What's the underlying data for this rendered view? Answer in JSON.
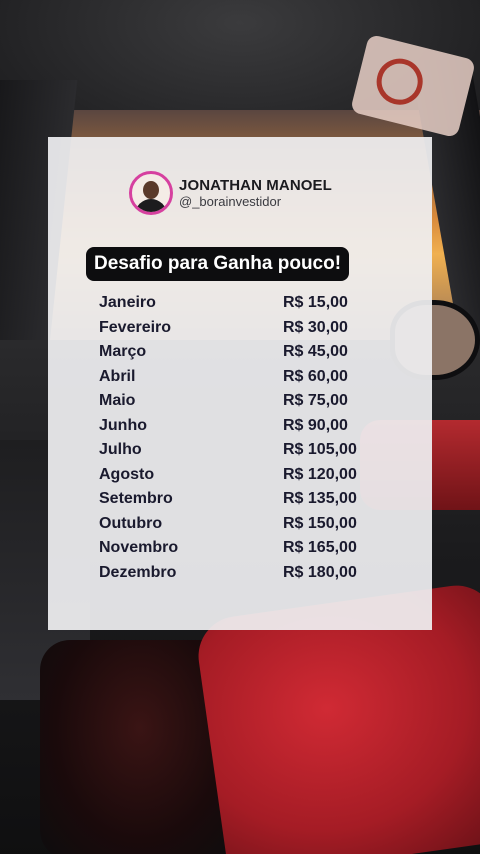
{
  "profile": {
    "name": "JONATHAN MANOEL",
    "handle": "@_borainvestidor"
  },
  "title": "Desafio para Ganha pouco!",
  "rows": [
    {
      "month": "Janeiro",
      "amount": "R$ 15,00"
    },
    {
      "month": "Fevereiro",
      "amount": "R$ 30,00"
    },
    {
      "month": "Março",
      "amount": "R$ 45,00"
    },
    {
      "month": "Abril",
      "amount": "R$ 60,00"
    },
    {
      "month": "Maio",
      "amount": "R$ 75,00"
    },
    {
      "month": "Junho",
      "amount": "R$ 90,00"
    },
    {
      "month": "Julho",
      "amount": "R$ 105,00"
    },
    {
      "month": "Agosto",
      "amount": "R$ 120,00"
    },
    {
      "month": "Setembro",
      "amount": "R$ 135,00"
    },
    {
      "month": "Outubro",
      "amount": "R$ 150,00"
    },
    {
      "month": "Novembro",
      "amount": "R$ 165,00"
    },
    {
      "month": "Dezembro",
      "amount": "R$ 180,00"
    }
  ],
  "colors": {
    "avatar_ring": "#d6409f",
    "title_bg": "#0d0d0f",
    "card_bg": "#efeff1"
  }
}
